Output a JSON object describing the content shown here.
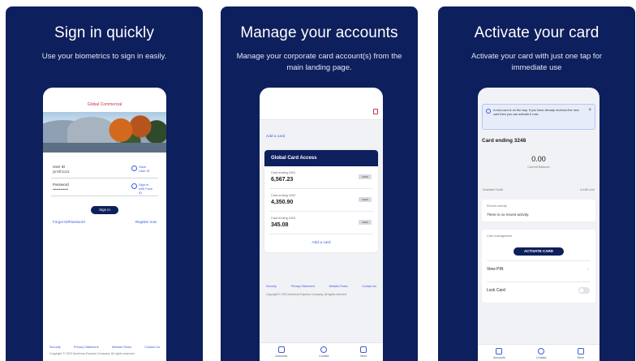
{
  "panels": [
    {
      "title": "Sign in quickly",
      "subtitle": "Use your biometrics to sign in easily.",
      "phone": {
        "brand": "Global Commercial",
        "user_id_label": "User ID",
        "user_id_value": "jsmith1111",
        "password_label": "Password",
        "password_value": "••••••••••••",
        "save_label": "Save User ID",
        "biometric_label": "Sign in with Face ID",
        "signin_label": "Sign in",
        "forgot_label": "Forgot ID/Password",
        "register_label": "Register now",
        "footer_links": [
          "Security",
          "Privacy Statement",
          "Website Rules",
          "Contact Us"
        ],
        "footer_text": "Copyright © 2023 American Express Company. All rights reserved."
      }
    },
    {
      "title": "Manage your accounts",
      "subtitle": "Manage your corporate card account(s) from the main landing page.",
      "phone": {
        "add_card_top": "Add a card",
        "card_header": "Global Card Access",
        "accounts": [
          {
            "label": "Card ending 1001",
            "amount": "6,567.23",
            "badge": "VIEW"
          },
          {
            "label": "Card ending 1002",
            "amount": "4,350.90",
            "badge": "VIEW"
          },
          {
            "label": "Card ending 1003",
            "amount": "345.08",
            "badge": "VIEW"
          }
        ],
        "add_card_bottom": "Add a card",
        "footer_links": [
          "Security",
          "Privacy Statement",
          "Website Rules",
          "Contact Us"
        ],
        "footer_text": "Copyright © 2023 American Express Company. All rights reserved.",
        "nav": [
          {
            "label": "Accounts",
            "icon": "home-icon"
          },
          {
            "label": "Contact",
            "icon": "phone-icon"
          },
          {
            "label": "More",
            "icon": "menu-icon"
          }
        ]
      }
    },
    {
      "title": "Activate your card",
      "subtitle": "Activate your card with just one tap for immediate use",
      "phone": {
        "banner_text": "A new card is on the way. If you have already received the new card then you can activate it now.",
        "card_ending": "Card ending 3248",
        "balance": "0.00",
        "balance_label": "Current Balance",
        "balance_left": "Available Credit",
        "balance_right": "Credit Limit",
        "recent_header": "Recent activity",
        "recent_text": "There is no recent activity.",
        "manage_header": "Card management",
        "activate_label": "ACTIVATE CARD",
        "view_pin_label": "View PIN",
        "lock_card_label": "Lock Card",
        "nav": [
          {
            "label": "Accounts",
            "icon": "home-icon"
          },
          {
            "label": "Contact",
            "icon": "phone-icon"
          },
          {
            "label": "More",
            "icon": "menu-icon"
          }
        ]
      }
    }
  ]
}
